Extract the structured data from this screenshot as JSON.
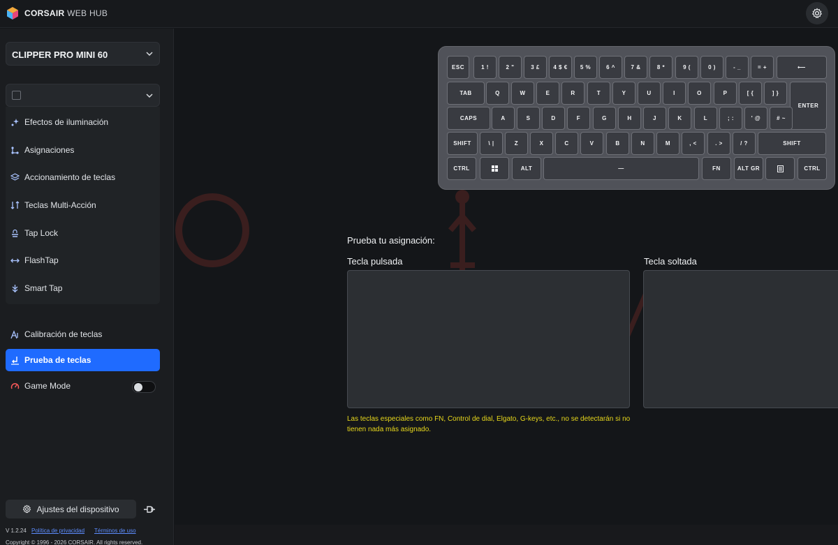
{
  "app": {
    "brand": "CORSAIR",
    "brand_sub": " WEB HUB"
  },
  "header": {
    "settings_icon": "gear-icon"
  },
  "sidebar": {
    "device_name": "CLIPPER PRO MINI 60",
    "profile_value": "",
    "menu": [
      {
        "label": "Efectos de iluminación",
        "icon": "sparkle-icon"
      },
      {
        "label": "Asignaciones",
        "icon": "assignments-icon"
      },
      {
        "label": "Accionamiento de teclas",
        "icon": "layers-icon"
      },
      {
        "label": "Teclas Multi-Acción",
        "icon": "multi-arrow-icon"
      },
      {
        "label": "Tap Lock",
        "icon": "tap-lock-icon"
      },
      {
        "label": "FlashTap",
        "icon": "flashtap-icon"
      },
      {
        "label": "Smart Tap",
        "icon": "smart-tap-icon"
      }
    ],
    "calibration_label": "Calibración de teclas",
    "key_test_label": "Prueba de teclas",
    "game_mode_label": "Game Mode",
    "game_mode_on": false,
    "device_settings_label": "Ajustes del dispositivo",
    "version": "V 1.2.24",
    "privacy_link": "Política de privacidad",
    "terms_link": "Términos de uso",
    "copyright": "Copyright © 1996 - 2026 CORSAIR. All rights reserved."
  },
  "keyboard": {
    "rows": [
      [
        "ESC",
        "1 !",
        "2 \"",
        "3 £",
        "4 $ €",
        "5 %",
        "6 ^",
        "7 &",
        "8 *",
        "9 (",
        "0 )",
        "- _",
        "= +",
        "⟵"
      ],
      [
        "TAB",
        "Q",
        "W",
        "E",
        "R",
        "T",
        "Y",
        "U",
        "I",
        "O",
        "P",
        "[ {",
        "] }",
        "ENTER"
      ],
      [
        "CAPS",
        "A",
        "S",
        "D",
        "F",
        "G",
        "H",
        "J",
        "K",
        "L",
        "; :",
        "' @",
        "# ~"
      ],
      [
        "SHIFT",
        "\\ |",
        "Z",
        "X",
        "C",
        "V",
        "B",
        "N",
        "M",
        ", <",
        ". >",
        "/ ?",
        "SHIFT"
      ],
      [
        "CTRL",
        "win-icon",
        "ALT",
        "—",
        "FN",
        "ALT GR",
        "menu-icon",
        "CTRL"
      ]
    ]
  },
  "test": {
    "title": "Prueba tu asignación:",
    "pressed_label": "Tecla pulsada",
    "released_label": "Tecla soltada",
    "note": "Las teclas especiales como FN, Control de dial, Elgato, G-keys, etc., no se detectarán si no tienen nada más asignado."
  },
  "colors": {
    "accent": "#1f6bff",
    "note": "#e8d81c",
    "background": "#141619"
  }
}
